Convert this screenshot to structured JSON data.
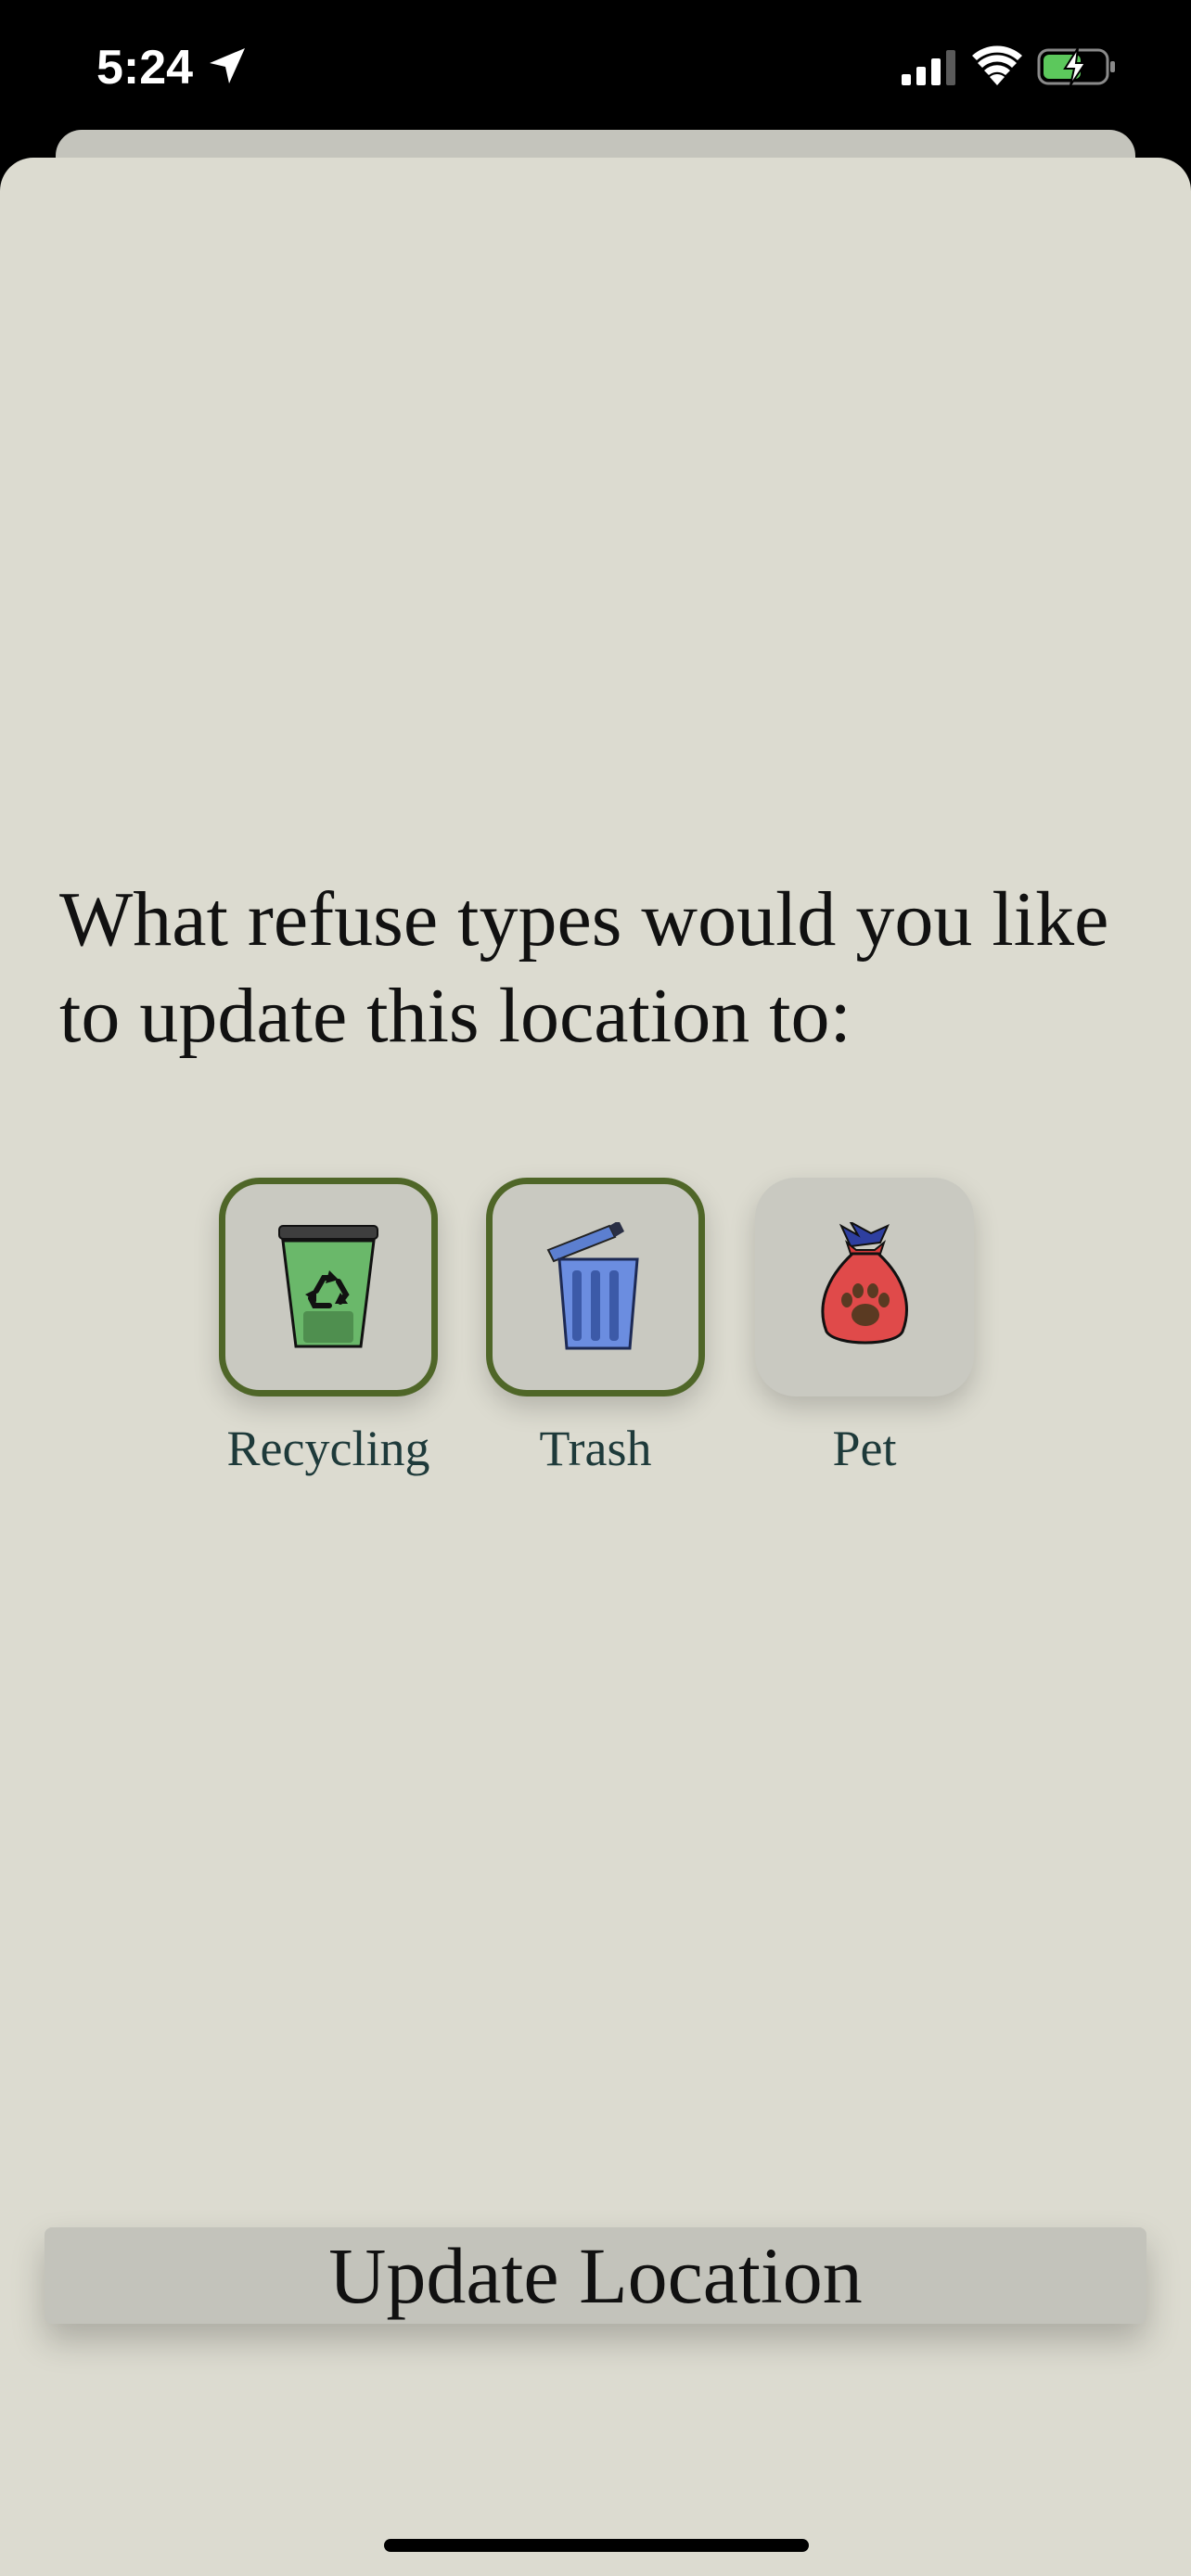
{
  "status_bar": {
    "time": "5:24",
    "icons": [
      "location-arrow-icon",
      "cellular-signal-icon",
      "wifi-icon",
      "battery-charging-icon"
    ]
  },
  "prompt": {
    "text": "What refuse types would you like to update this location to:"
  },
  "refuse_options": [
    {
      "label": "Recycling",
      "icon": "recycling-bin-icon",
      "selected": true
    },
    {
      "label": "Trash",
      "icon": "trash-can-icon",
      "selected": true
    },
    {
      "label": "Pet",
      "icon": "pet-waste-bag-icon",
      "selected": false
    }
  ],
  "actions": {
    "update_label": "Update Location"
  },
  "colors": {
    "background": "#dcdbd0",
    "tile": "#c9c9c1",
    "selected_border": "#4f6628",
    "label_text": "#1e3a3a",
    "button": "#c3c3bb"
  }
}
